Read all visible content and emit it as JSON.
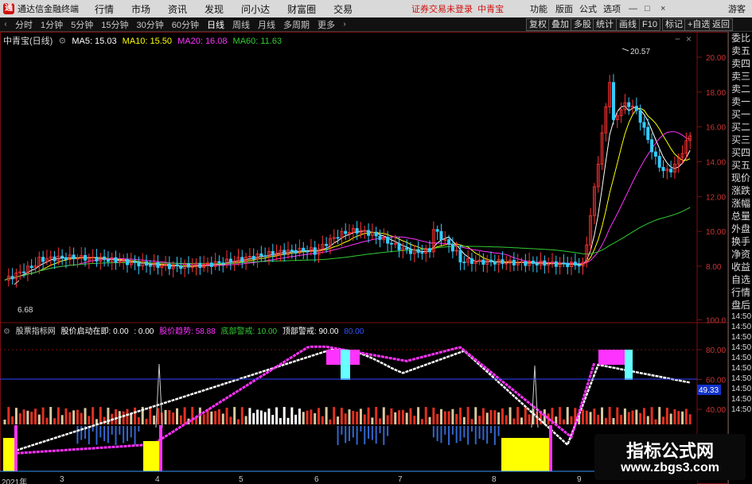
{
  "app": {
    "title": "通达信金融终端",
    "menu": [
      "行情",
      "市场",
      "资讯",
      "发现",
      "问小达",
      "财富圈",
      "交易"
    ],
    "notice": "证券交易未登录",
    "stock_label": "中青宝",
    "right_menu": [
      "功能",
      "版面",
      "公式",
      "选项"
    ],
    "guest": "游客"
  },
  "toolbar": {
    "periods": [
      "分时",
      "1分钟",
      "5分钟",
      "15分钟",
      "30分钟",
      "60分钟",
      "日线",
      "周线",
      "月线",
      "多周期",
      "更多"
    ],
    "active_period": "日线",
    "right_buttons": [
      "复权",
      "叠加",
      "多股",
      "统计",
      "画线",
      "F10",
      "标记",
      "+自选",
      "返回"
    ]
  },
  "price_chart": {
    "stock": "中青宝(日线)",
    "ma": [
      {
        "label": "MA5: 15.03",
        "color": "#ffffff"
      },
      {
        "label": "MA10: 15.50",
        "color": "#ffff00"
      },
      {
        "label": "MA20: 16.08",
        "color": "#ff33ff"
      },
      {
        "label": "MA60: 11.63",
        "color": "#33cc33"
      }
    ],
    "y_ticks": [
      "20.00",
      "18.00",
      "16.00",
      "14.00",
      "12.00",
      "10.00",
      "8.00"
    ],
    "high_label": "20.57",
    "low_label": "6.68"
  },
  "indicator": {
    "name": "股票指标网",
    "items": [
      {
        "label": "股价启动在即: 0.00",
        "color": "#ffffff"
      },
      {
        "label": ": 0.00",
        "color": "#ffffff"
      },
      {
        "label": "股价趋势: 58.88",
        "color": "#ff33ff"
      },
      {
        "label": "底部警戒: 10.00",
        "color": "#33cc33"
      },
      {
        "label": "顶部警戒: 90.00",
        "color": "#ffffff"
      },
      {
        "label": "80.00",
        "color": "#3355ff"
      }
    ],
    "y_ticks": [
      "100.0",
      "80.00",
      "60.00",
      "40.00"
    ],
    "current_value": "49.33"
  },
  "dates": [
    "2021年",
    "3",
    "4",
    "5",
    "6",
    "7",
    "8",
    "9"
  ],
  "right_panel": [
    "委比",
    "卖五",
    "卖四",
    "卖三",
    "卖二",
    "卖一",
    "买一",
    "买二",
    "买三",
    "买四",
    "买五",
    "现价",
    "涨跌",
    "涨幅",
    "总量",
    "外盘",
    "换手",
    "净资",
    "收益",
    "自选",
    "行情",
    "盘后",
    "14:50",
    "14:50",
    "14:50",
    "14:50",
    "14:50",
    "14:50",
    "14:50",
    "14:50",
    "14:50",
    "14:50"
  ],
  "watermark": {
    "line1": "指标公式网",
    "line2": "www.zbgs3.com"
  }
}
